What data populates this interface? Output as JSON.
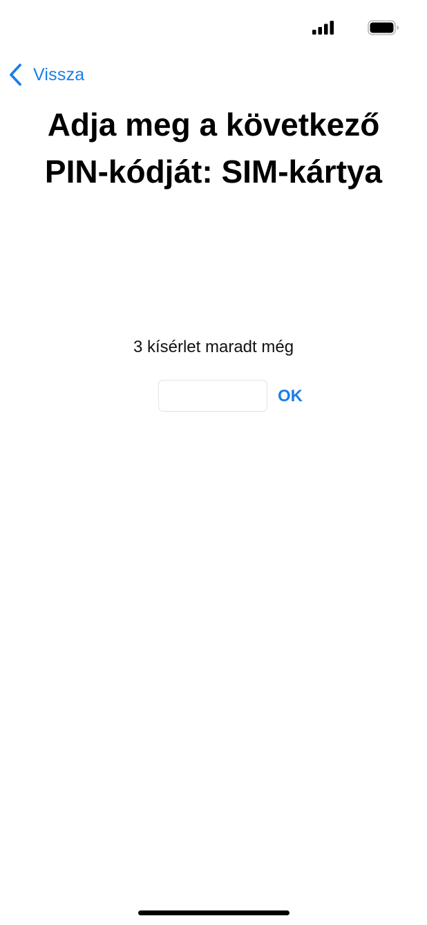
{
  "status_bar": {
    "signal_icon": "cellular-signal-icon",
    "battery_icon": "battery-full-icon"
  },
  "navigation": {
    "back_label": "Vissza",
    "back_icon": "chevron-left-icon",
    "accent_color": "#1a7ee8"
  },
  "page": {
    "title": "Adja meg a következő PIN-kódját: SIM-kártya",
    "attempts_text": "3 kísérlet maradt még"
  },
  "pin_form": {
    "input_value": "",
    "input_placeholder": "",
    "ok_label": "OK"
  }
}
